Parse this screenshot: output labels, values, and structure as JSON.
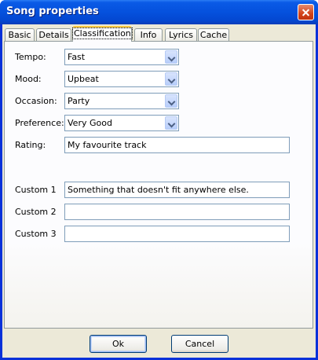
{
  "window": {
    "title": "Song properties"
  },
  "tabs": [
    {
      "label": "Basic",
      "active": false
    },
    {
      "label": "Details",
      "active": false
    },
    {
      "label": "Classification",
      "active": true
    },
    {
      "label": "Info",
      "active": false
    },
    {
      "label": "Lyrics",
      "active": false
    },
    {
      "label": "Cache",
      "active": false
    }
  ],
  "fields": {
    "tempo": {
      "label": "Tempo:",
      "value": "Fast"
    },
    "mood": {
      "label": "Mood:",
      "value": "Upbeat"
    },
    "occasion": {
      "label": "Occasion:",
      "value": "Party"
    },
    "preference": {
      "label": "Preference:",
      "value": "Very Good"
    },
    "rating": {
      "label": "Rating:",
      "value": "My favourite track"
    },
    "custom1": {
      "label": "Custom 1",
      "value": "Something that doesn't fit anywhere else."
    },
    "custom2": {
      "label": "Custom 2",
      "value": ""
    },
    "custom3": {
      "label": "Custom 3",
      "value": ""
    }
  },
  "buttons": {
    "ok": "Ok",
    "cancel": "Cancel"
  }
}
